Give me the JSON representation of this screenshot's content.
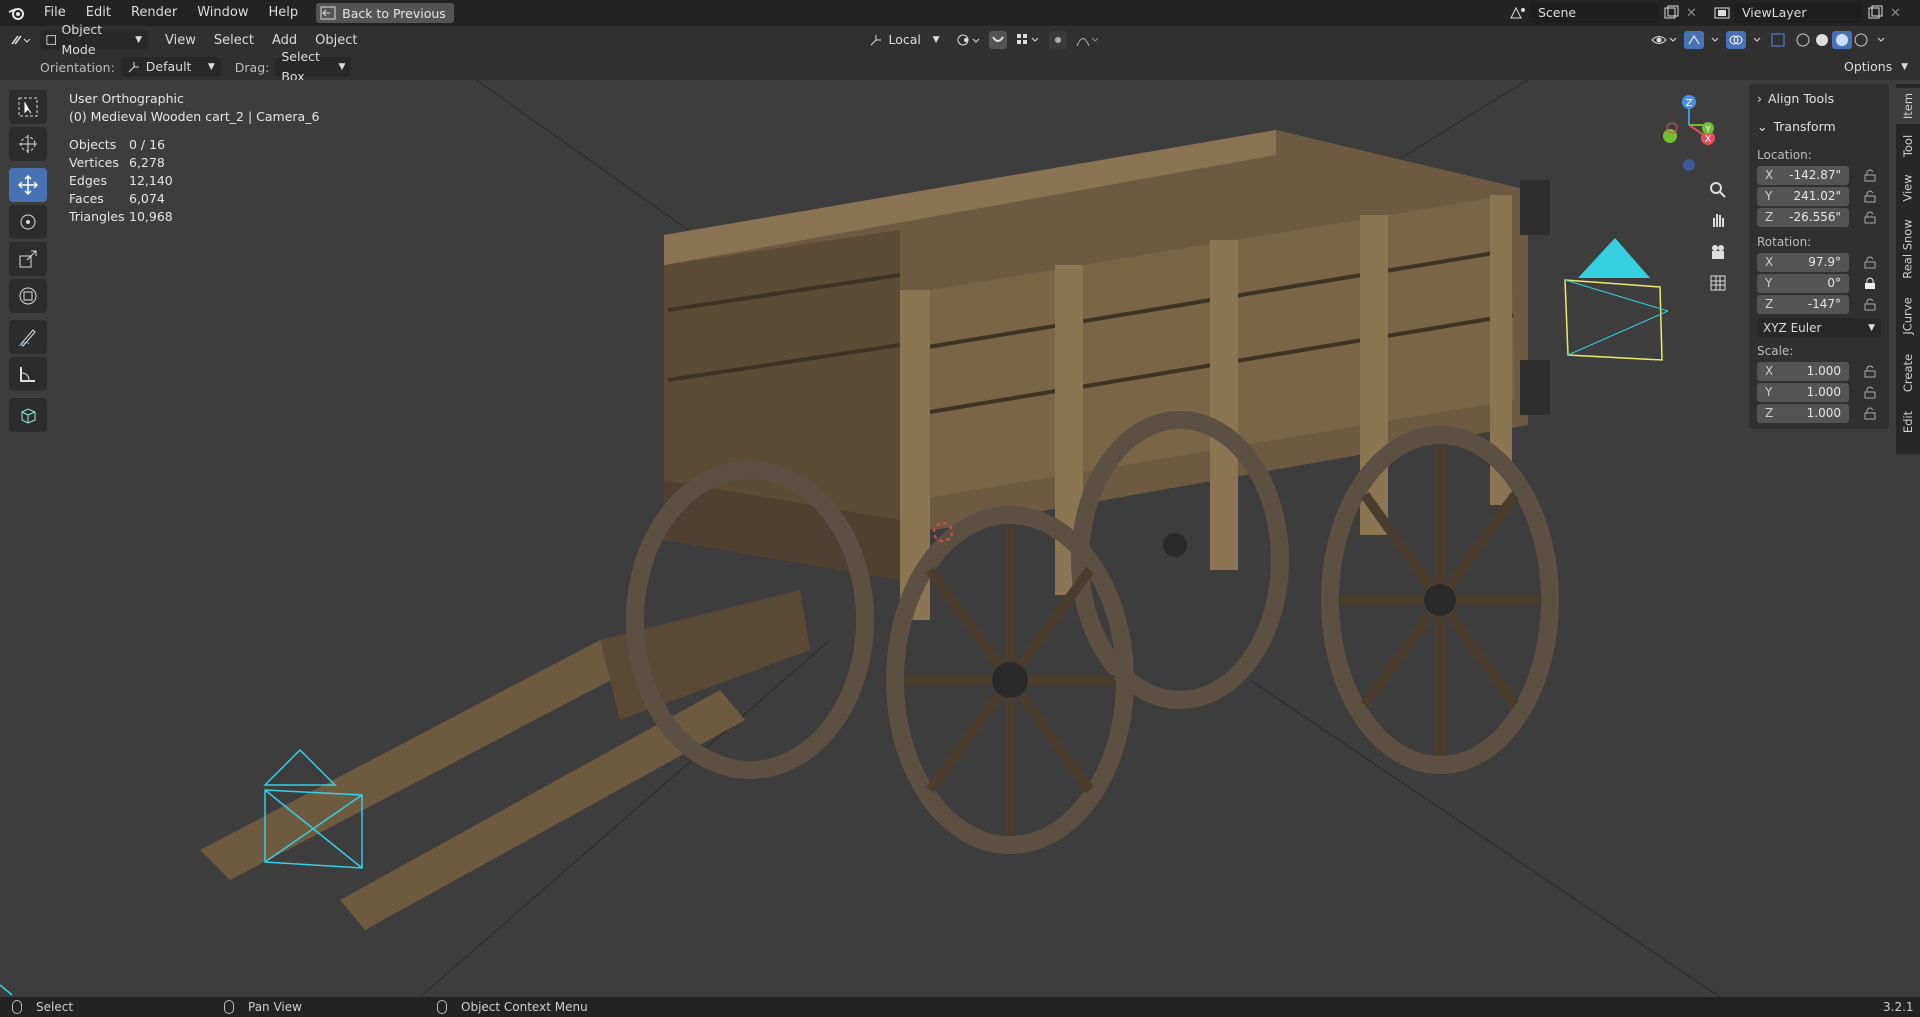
{
  "topbar": {
    "menu": [
      "File",
      "Edit",
      "Render",
      "Window",
      "Help"
    ],
    "back_button": "Back to Previous",
    "scene": "Scene",
    "view_layer": "ViewLayer"
  },
  "header": {
    "mode": "Object Mode",
    "menus": [
      "View",
      "Select",
      "Add",
      "Object"
    ],
    "transform_orientation": "Local",
    "options": "Options",
    "orientation_label": "Orientation:",
    "orientation_value": "Default",
    "drag_label": "Drag:",
    "drag_value": "Select Box"
  },
  "viewport": {
    "view_name": "User Orthographic",
    "object_info": "(0) Medieval Wooden cart_2 | Camera_6",
    "stats": [
      {
        "label": "Objects",
        "value": "0 / 16"
      },
      {
        "label": "Vertices",
        "value": "6,278"
      },
      {
        "label": "Edges",
        "value": "12,140"
      },
      {
        "label": "Faces",
        "value": "6,074"
      },
      {
        "label": "Triangles",
        "value": "10,968"
      }
    ],
    "gizmo": {
      "z": "Z",
      "x": "X",
      "y": "Y"
    }
  },
  "npanel": {
    "align_tools": "Align Tools",
    "transform": "Transform",
    "location_label": "Location:",
    "location": [
      {
        "axis": "X",
        "value": "-142.87\""
      },
      {
        "axis": "Y",
        "value": "241.02\""
      },
      {
        "axis": "Z",
        "value": "-26.556\""
      }
    ],
    "rotation_label": "Rotation:",
    "rotation": [
      {
        "axis": "X",
        "value": "97.9°"
      },
      {
        "axis": "Y",
        "value": "0°"
      },
      {
        "axis": "Z",
        "value": "-147°"
      }
    ],
    "rotation_mode": "XYZ Euler",
    "scale_label": "Scale:",
    "scale": [
      {
        "axis": "X",
        "value": "1.000"
      },
      {
        "axis": "Y",
        "value": "1.000"
      },
      {
        "axis": "Z",
        "value": "1.000"
      }
    ]
  },
  "tabs": [
    "Item",
    "Tool",
    "View",
    "Real Snow",
    "JCurve",
    "Create",
    "Edit"
  ],
  "status": {
    "select": "Select",
    "pan_view": "Pan View",
    "context_menu": "Object Context Menu",
    "version": "3.2.1"
  },
  "colors": {
    "accent": "#4772b3",
    "camera_cyan": "#35d0e0",
    "active_camera": "#e8e86a"
  }
}
